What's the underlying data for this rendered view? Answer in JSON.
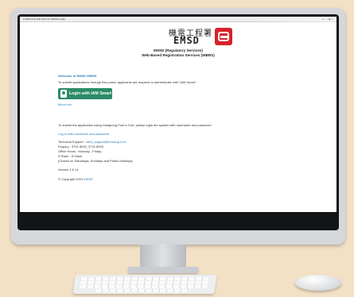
{
  "logo": {
    "chinese_name": "機電工程署",
    "short_name": "EMSD"
  },
  "header": {
    "org": "EMSD (Regulatory Services)",
    "service": "Web-Based Registration Services (WBRS)"
  },
  "content": {
    "welcome": "Welcome to EMSD WBRS",
    "instruction": "To submit applications through this portal, applicants are required to authenticate with \"iAM Smart\" .",
    "iam_button_label": "Login with iAM Smart",
    "more_info_link": "More Info",
    "postecert_note": "To submit the application using Hongkong Post e-Cert, please login the system with username and password",
    "login_link": "Log in with username and password",
    "support_label": "Technical Support :",
    "support_email": "wbrs_support@emsd.gov.hk",
    "enquiry": "Enquiry : 3741 8092, 3741 8093",
    "office_hours": "Office Hours : Monday - Friday",
    "hours": "9:30am - 5:15pm",
    "closed": "(Closed on Saturdays, Sundays and Public Holidays)",
    "version": "Version 1.5.14",
    "copyright_prefix": "© Copyright 2021",
    "copyright_link": "EMSD"
  }
}
